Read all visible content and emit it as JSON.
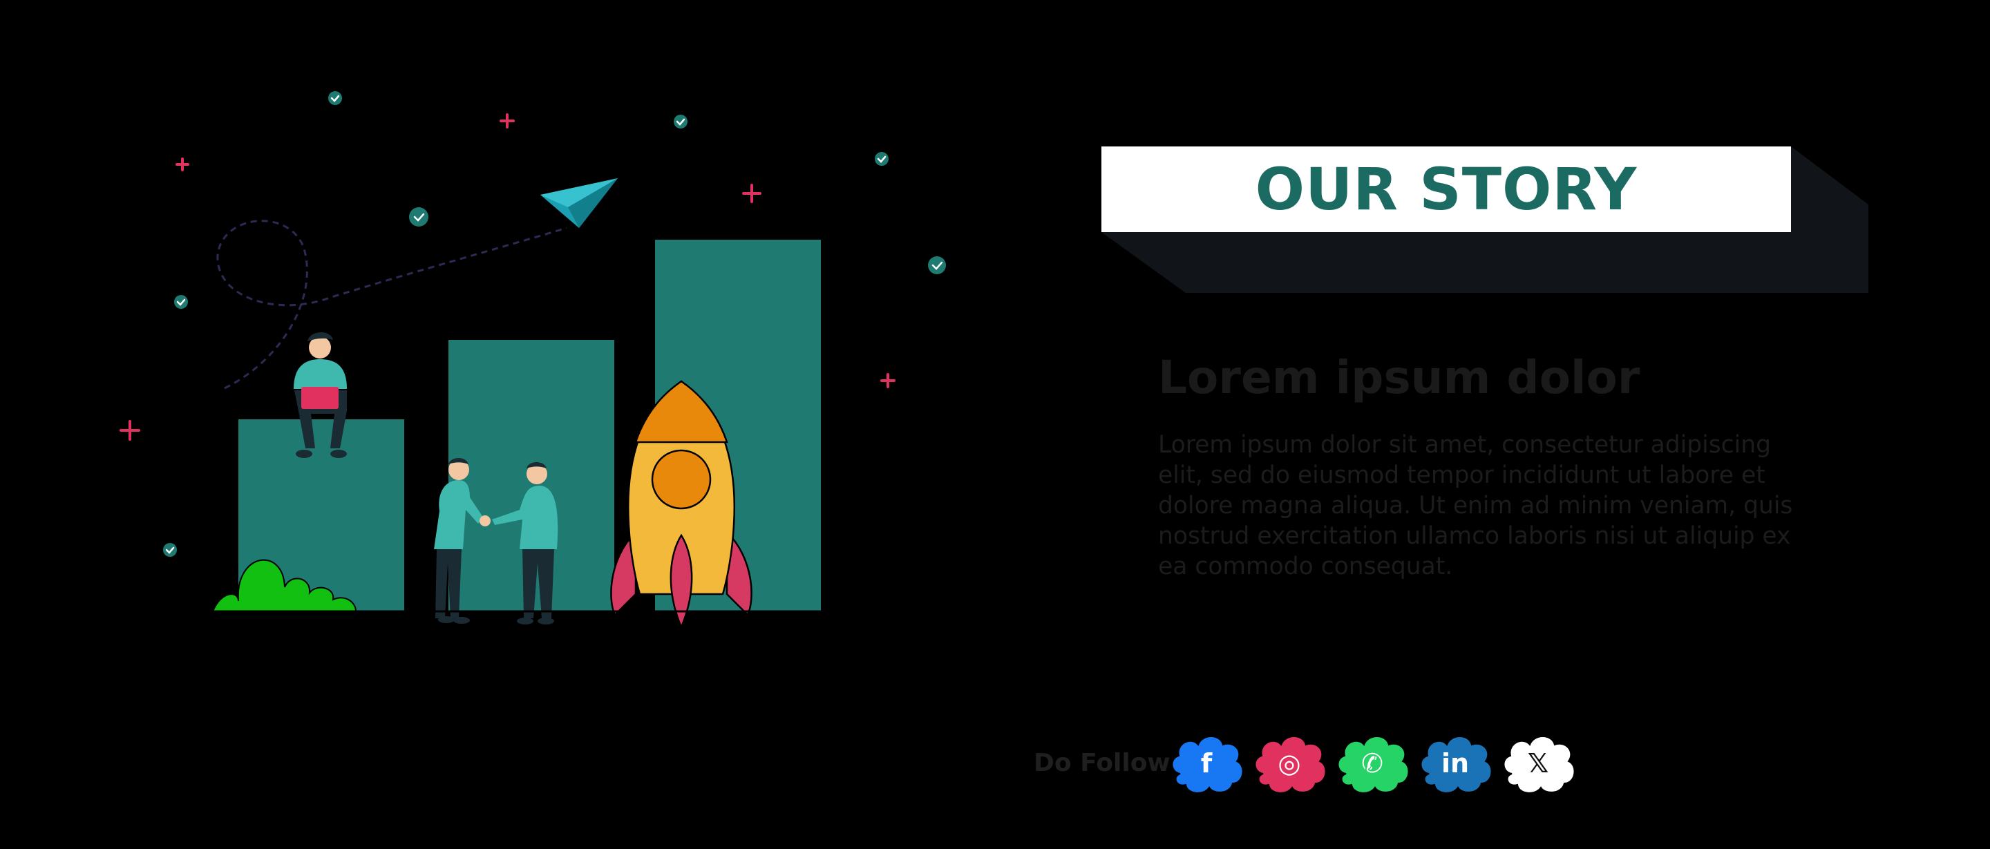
{
  "banner": {
    "title": "OUR STORY"
  },
  "content": {
    "heading": "Lorem ipsum dolor",
    "body": "Lorem ipsum dolor sit amet, consectetur adipiscing elit, sed do eiusmod tempor incididunt ut labore et dolore magna aliqua. Ut enim ad minim veniam, quis nostrud exercitation ullamco laboris nisi ut aliquip ex ea commodo consequat."
  },
  "social": {
    "label": "Do Follow",
    "links": [
      {
        "name": "facebook-icon",
        "glyph": "f",
        "color": "#1877f2"
      },
      {
        "name": "instagram-icon",
        "glyph": "◎",
        "color": "#e0315f"
      },
      {
        "name": "whatsapp-icon",
        "glyph": "✆",
        "color": "#25d366"
      },
      {
        "name": "linkedin-icon",
        "glyph": "in",
        "color": "#1a73b6"
      },
      {
        "name": "x-icon",
        "glyph": "𝕏",
        "color": "#ffffff"
      }
    ]
  },
  "colors": {
    "teal": "#1f7a72",
    "teal_dark": "#1c6b63",
    "pink": "#e0315f",
    "rocket_body": "#f2b93b",
    "rocket_orange": "#e8890b",
    "plant": "#12c012"
  }
}
